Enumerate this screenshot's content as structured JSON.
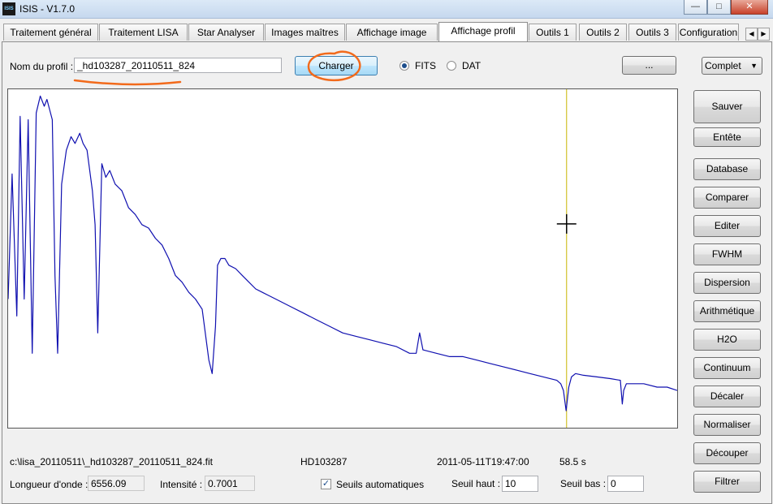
{
  "window": {
    "title": "ISIS - V1.7.0",
    "app_icon_text": "ISIS",
    "controls": {
      "minimize": "—",
      "maximize": "□",
      "close": "✕"
    }
  },
  "tabs": [
    {
      "label": "Traitement général",
      "active": false
    },
    {
      "label": "Traitement LISA",
      "active": false
    },
    {
      "label": "Star Analyser",
      "active": false
    },
    {
      "label": "Images maîtres",
      "active": false
    },
    {
      "label": "Affichage image",
      "active": false
    },
    {
      "label": "Affichage profil",
      "active": true
    },
    {
      "label": "Outils 1",
      "active": false
    },
    {
      "label": "Outils 2",
      "active": false
    },
    {
      "label": "Outils 3",
      "active": false
    },
    {
      "label": "Configuration",
      "active": false
    }
  ],
  "tab_scroll": {
    "left": "◀",
    "right": "▶"
  },
  "profile": {
    "label": "Nom du profil :",
    "value": "_hd103287_20110511_824",
    "load_button": "Charger",
    "format_fits": "FITS",
    "format_dat": "DAT",
    "selected_format": "FITS",
    "browse_button": "...",
    "mode_value": "Complet",
    "mode_arrow": "▼"
  },
  "side_buttons": [
    "Sauver",
    "Entête",
    "Database",
    "Comparer",
    "Editer",
    "FWHM",
    "Dispersion",
    "Arithmétique",
    "H2O",
    "Continuum",
    "Décaler",
    "Normaliser",
    "Découper",
    "Filtrer"
  ],
  "status": {
    "file_path": "c:\\lisa_20110511\\_hd103287_20110511_824.fit",
    "object": "HD103287",
    "date": "2011-05-11T19:47:00",
    "exposure": "58.5 s",
    "wavelength_label": "Longueur d'onde :",
    "wavelength_value": "6556.09",
    "intensity_label": "Intensité :",
    "intensity_value": "0.7001",
    "auto_thresholds_label": "Seuils automatiques",
    "auto_thresholds_checked": true,
    "high_threshold_label": "Seuil haut :",
    "high_threshold_value": "10",
    "low_threshold_label": "Seuil bas :",
    "low_threshold_value": "0"
  },
  "annotations": {
    "color": "#f26a1b"
  },
  "chart_data": {
    "type": "line",
    "series_color": "#1010b0",
    "cursor_line_color": "#c8b400",
    "cursor_x": 0.8347,
    "cursor_y": 0.3978,
    "x": [
      0.0,
      0.006,
      0.013,
      0.018,
      0.024,
      0.03,
      0.036,
      0.042,
      0.048,
      0.054,
      0.058,
      0.062,
      0.066,
      0.07,
      0.074,
      0.08,
      0.087,
      0.094,
      0.1,
      0.107,
      0.112,
      0.118,
      0.122,
      0.126,
      0.13,
      0.134,
      0.14,
      0.146,
      0.152,
      0.16,
      0.17,
      0.18,
      0.19,
      0.2,
      0.21,
      0.22,
      0.23,
      0.24,
      0.25,
      0.26,
      0.27,
      0.28,
      0.29,
      0.3,
      0.305,
      0.31,
      0.313,
      0.318,
      0.324,
      0.33,
      0.34,
      0.35,
      0.36,
      0.37,
      0.38,
      0.39,
      0.4,
      0.42,
      0.44,
      0.46,
      0.48,
      0.5,
      0.52,
      0.54,
      0.56,
      0.58,
      0.6,
      0.61,
      0.615,
      0.62,
      0.64,
      0.66,
      0.68,
      0.7,
      0.72,
      0.74,
      0.76,
      0.78,
      0.8,
      0.82,
      0.826,
      0.83,
      0.834,
      0.838,
      0.842,
      0.848,
      0.86,
      0.88,
      0.9,
      0.915,
      0.918,
      0.92,
      0.924,
      0.93,
      0.95,
      0.97,
      0.985,
      1.0
    ],
    "y": [
      0.62,
      0.25,
      0.67,
      0.08,
      0.62,
      0.09,
      0.78,
      0.07,
      0.02,
      0.05,
      0.03,
      0.06,
      0.09,
      0.55,
      0.78,
      0.28,
      0.18,
      0.14,
      0.16,
      0.13,
      0.16,
      0.18,
      0.24,
      0.3,
      0.4,
      0.72,
      0.22,
      0.26,
      0.24,
      0.28,
      0.3,
      0.35,
      0.37,
      0.4,
      0.41,
      0.44,
      0.46,
      0.5,
      0.55,
      0.57,
      0.6,
      0.62,
      0.65,
      0.8,
      0.84,
      0.7,
      0.52,
      0.5,
      0.5,
      0.52,
      0.53,
      0.55,
      0.57,
      0.59,
      0.6,
      0.61,
      0.62,
      0.64,
      0.66,
      0.68,
      0.7,
      0.72,
      0.73,
      0.74,
      0.75,
      0.76,
      0.78,
      0.78,
      0.72,
      0.77,
      0.78,
      0.79,
      0.79,
      0.8,
      0.81,
      0.82,
      0.83,
      0.84,
      0.85,
      0.86,
      0.87,
      0.89,
      0.95,
      0.88,
      0.85,
      0.84,
      0.845,
      0.85,
      0.855,
      0.86,
      0.93,
      0.89,
      0.87,
      0.87,
      0.87,
      0.88,
      0.88,
      0.89
    ]
  }
}
